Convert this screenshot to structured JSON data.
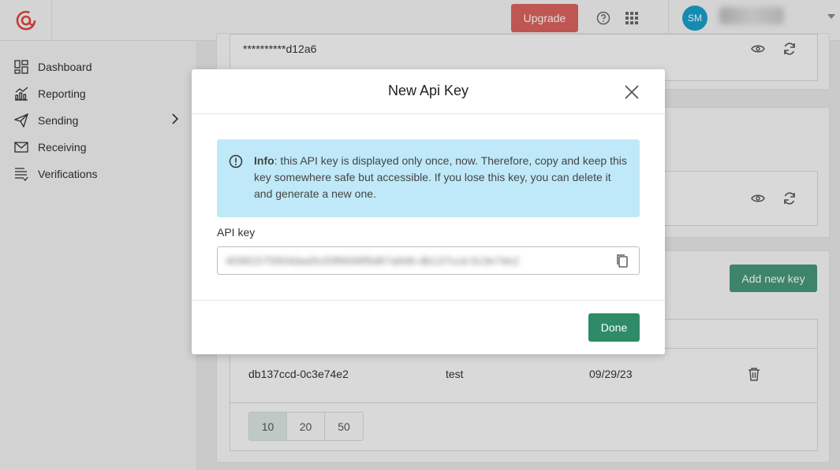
{
  "header": {
    "upgrade_label": "Upgrade",
    "avatar_initials": "SM"
  },
  "sidebar": {
    "items": [
      {
        "label": "Dashboard",
        "icon": "dashboard-icon"
      },
      {
        "label": "Reporting",
        "icon": "chart-icon"
      },
      {
        "label": "Sending",
        "icon": "paper-plane-icon"
      },
      {
        "label": "Receiving",
        "icon": "envelope-icon"
      },
      {
        "label": "Verifications",
        "icon": "list-check-icon"
      }
    ]
  },
  "main": {
    "key1_masked": "**********d12a6",
    "add_key_label": "Add new key",
    "table_row": {
      "key": "db137ccd-0c3e74e2",
      "name": "test",
      "date": "09/29/23"
    },
    "page_sizes": [
      "10",
      "20",
      "50"
    ],
    "active_page_size": "10"
  },
  "modal": {
    "title": "New Api Key",
    "info_label": "Info",
    "info_text": ": this API key is displayed only once, now. Therefore, copy and keep this key somewhere safe but accessible. If you lose this key, you can delete it and generate a new one.",
    "field_label": "API key",
    "field_value": "40981575904daa5c93f6848f9d67a846-db137ccd-0c3e74e2",
    "done_label": "Done"
  },
  "colors": {
    "brand": "#d9534f",
    "accent": "#2e8b68",
    "info_bg": "#bfe9f8",
    "avatar": "#1a9fc9"
  }
}
